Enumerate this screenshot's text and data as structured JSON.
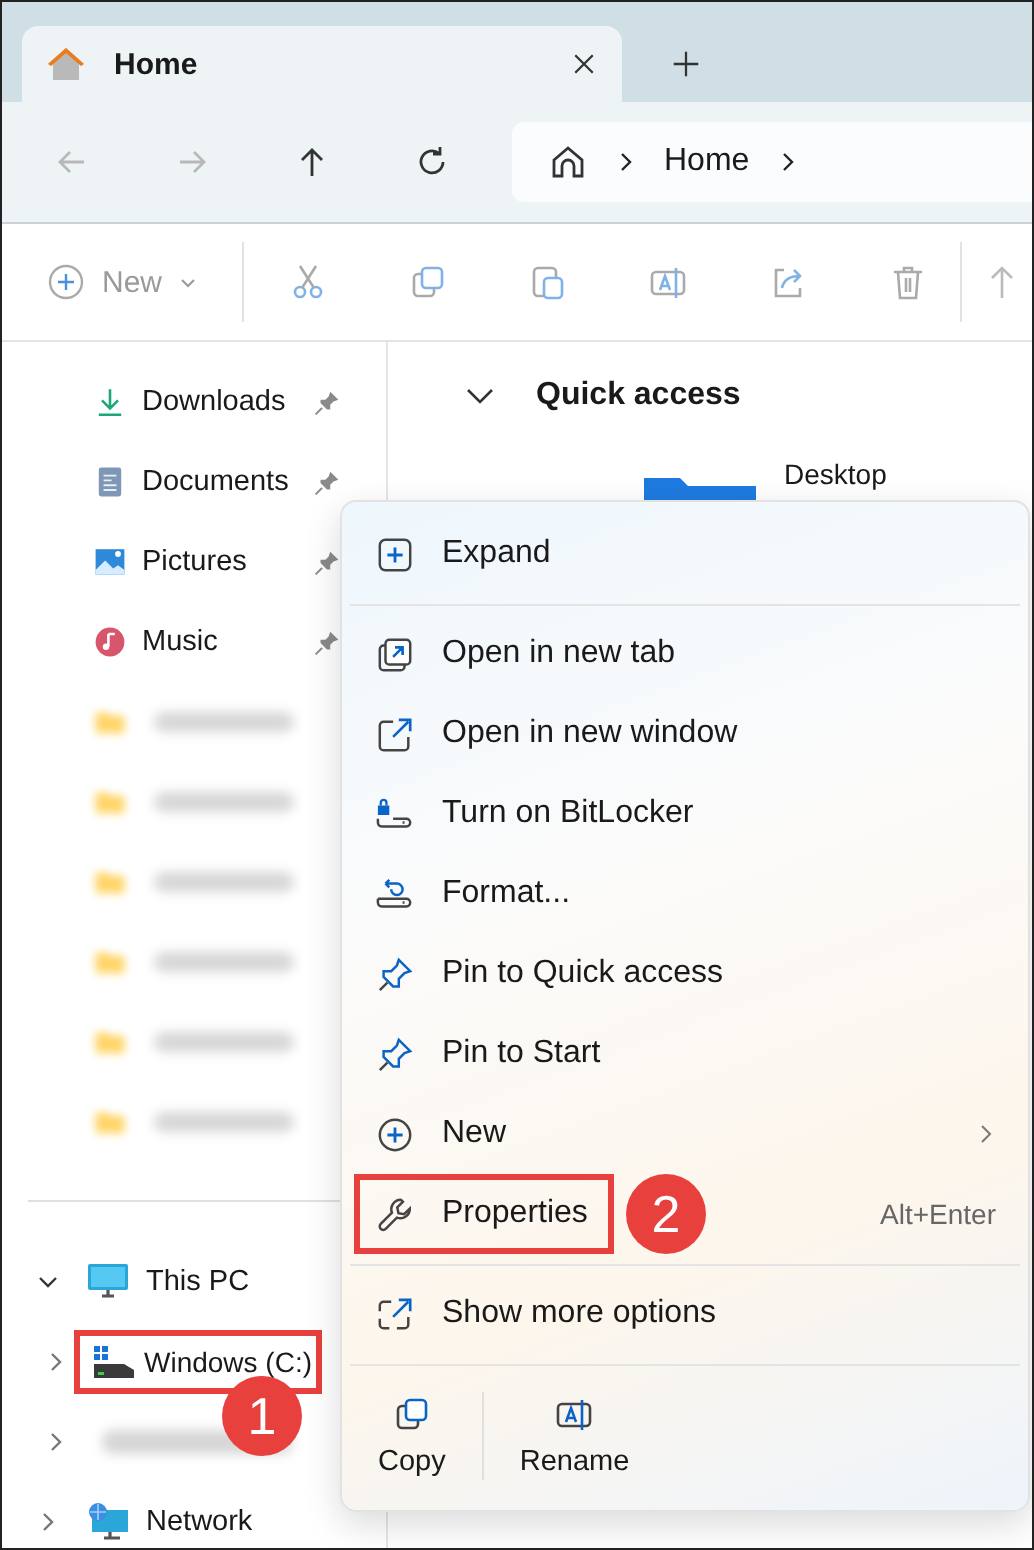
{
  "tab": {
    "title": "Home"
  },
  "nav": [
    {
      "kind": "back",
      "disabled": true
    },
    {
      "kind": "forward",
      "disabled": true
    },
    {
      "kind": "up",
      "disabled": false
    },
    {
      "kind": "refresh",
      "disabled": false
    }
  ],
  "address": {
    "crumbs": [
      "Home"
    ]
  },
  "toolbar": {
    "new_label": "New"
  },
  "sidebar": {
    "quick": [
      {
        "kind": "item",
        "label": "Downloads",
        "pinned": true
      },
      {
        "kind": "item",
        "label": "Documents",
        "pinned": true
      },
      {
        "kind": "item",
        "label": "Pictures",
        "pinned": true
      },
      {
        "kind": "item",
        "label": "Music",
        "pinned": true
      },
      {
        "kind": "blurred"
      },
      {
        "kind": "blurred"
      },
      {
        "kind": "blurred"
      },
      {
        "kind": "blurred"
      },
      {
        "kind": "blurred"
      },
      {
        "kind": "blurred"
      }
    ],
    "this_pc": {
      "label": "This PC",
      "expanded": true,
      "children": [
        {
          "kind": "drive",
          "label": "Windows (C:)",
          "highlighted": true,
          "badge": "1"
        },
        {
          "kind": "blurred",
          "highlighted": false
        }
      ]
    },
    "network": {
      "label": "Network",
      "expanded": false
    }
  },
  "content": {
    "section": "Quick access",
    "expanded": true,
    "items": [
      "Desktop"
    ]
  },
  "menu": {
    "items": [
      {
        "kind": "command",
        "label": "Expand",
        "highlighted": false
      },
      {
        "kind": "separator"
      },
      {
        "kind": "command",
        "label": "Open in new tab",
        "highlighted": false
      },
      {
        "kind": "command",
        "label": "Open in new window",
        "highlighted": false
      },
      {
        "kind": "command",
        "label": "Turn on BitLocker",
        "highlighted": false
      },
      {
        "kind": "command",
        "label": "Format...",
        "highlighted": false
      },
      {
        "kind": "command",
        "label": "Pin to Quick access",
        "highlighted": false
      },
      {
        "kind": "command",
        "label": "Pin to Start",
        "highlighted": false
      },
      {
        "kind": "command",
        "label": "New",
        "submenu": true,
        "highlighted": false
      },
      {
        "kind": "command",
        "label": "Properties",
        "shortcut": "Alt+Enter",
        "highlighted": true,
        "badge": "2"
      },
      {
        "kind": "separator"
      },
      {
        "kind": "command",
        "label": "Show more options",
        "highlighted": false
      }
    ],
    "actions": [
      {
        "label": "Copy"
      },
      {
        "label": "Rename"
      }
    ]
  }
}
